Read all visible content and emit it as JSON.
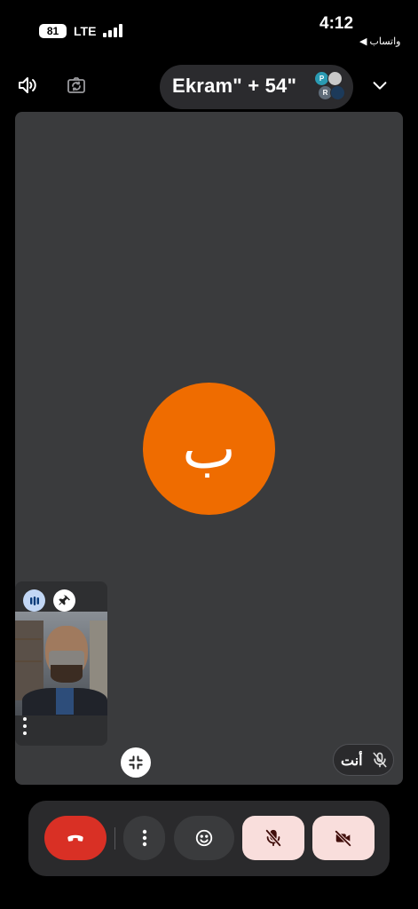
{
  "status_bar": {
    "battery": "81",
    "network": "LTE",
    "time": "4:12",
    "back_app": "◀ واتساب"
  },
  "header": {
    "title": "Ekram\" + 54\"",
    "avatars": [
      {
        "label": "P",
        "color": "#2a9bb3"
      },
      {
        "label": "",
        "color": "#c9c9c9"
      },
      {
        "label": "R",
        "color": "#5f6b78"
      },
      {
        "label": "",
        "color": "#1c3a5a"
      }
    ]
  },
  "main_participant": {
    "initial": "ب",
    "color": "#ef6c00"
  },
  "self_view": {
    "label": "أنت"
  },
  "icons": {
    "speaker": "speaker-icon",
    "flip": "flip-camera-icon",
    "collapse": "chevron-down-icon",
    "audio_levels": "audio-levels-icon",
    "pin": "pin-icon",
    "more": "more-vert-icon",
    "shrink": "shrink-icon",
    "mic_off": "mic-off-icon",
    "end_call": "end-call-icon",
    "emoji": "emoji-icon",
    "camera_off": "camera-off-icon"
  },
  "colors": {
    "end_call": "#d93025",
    "toggle_off_bg": "#f9dedc",
    "toggle_off_icon": "#410e0b"
  }
}
